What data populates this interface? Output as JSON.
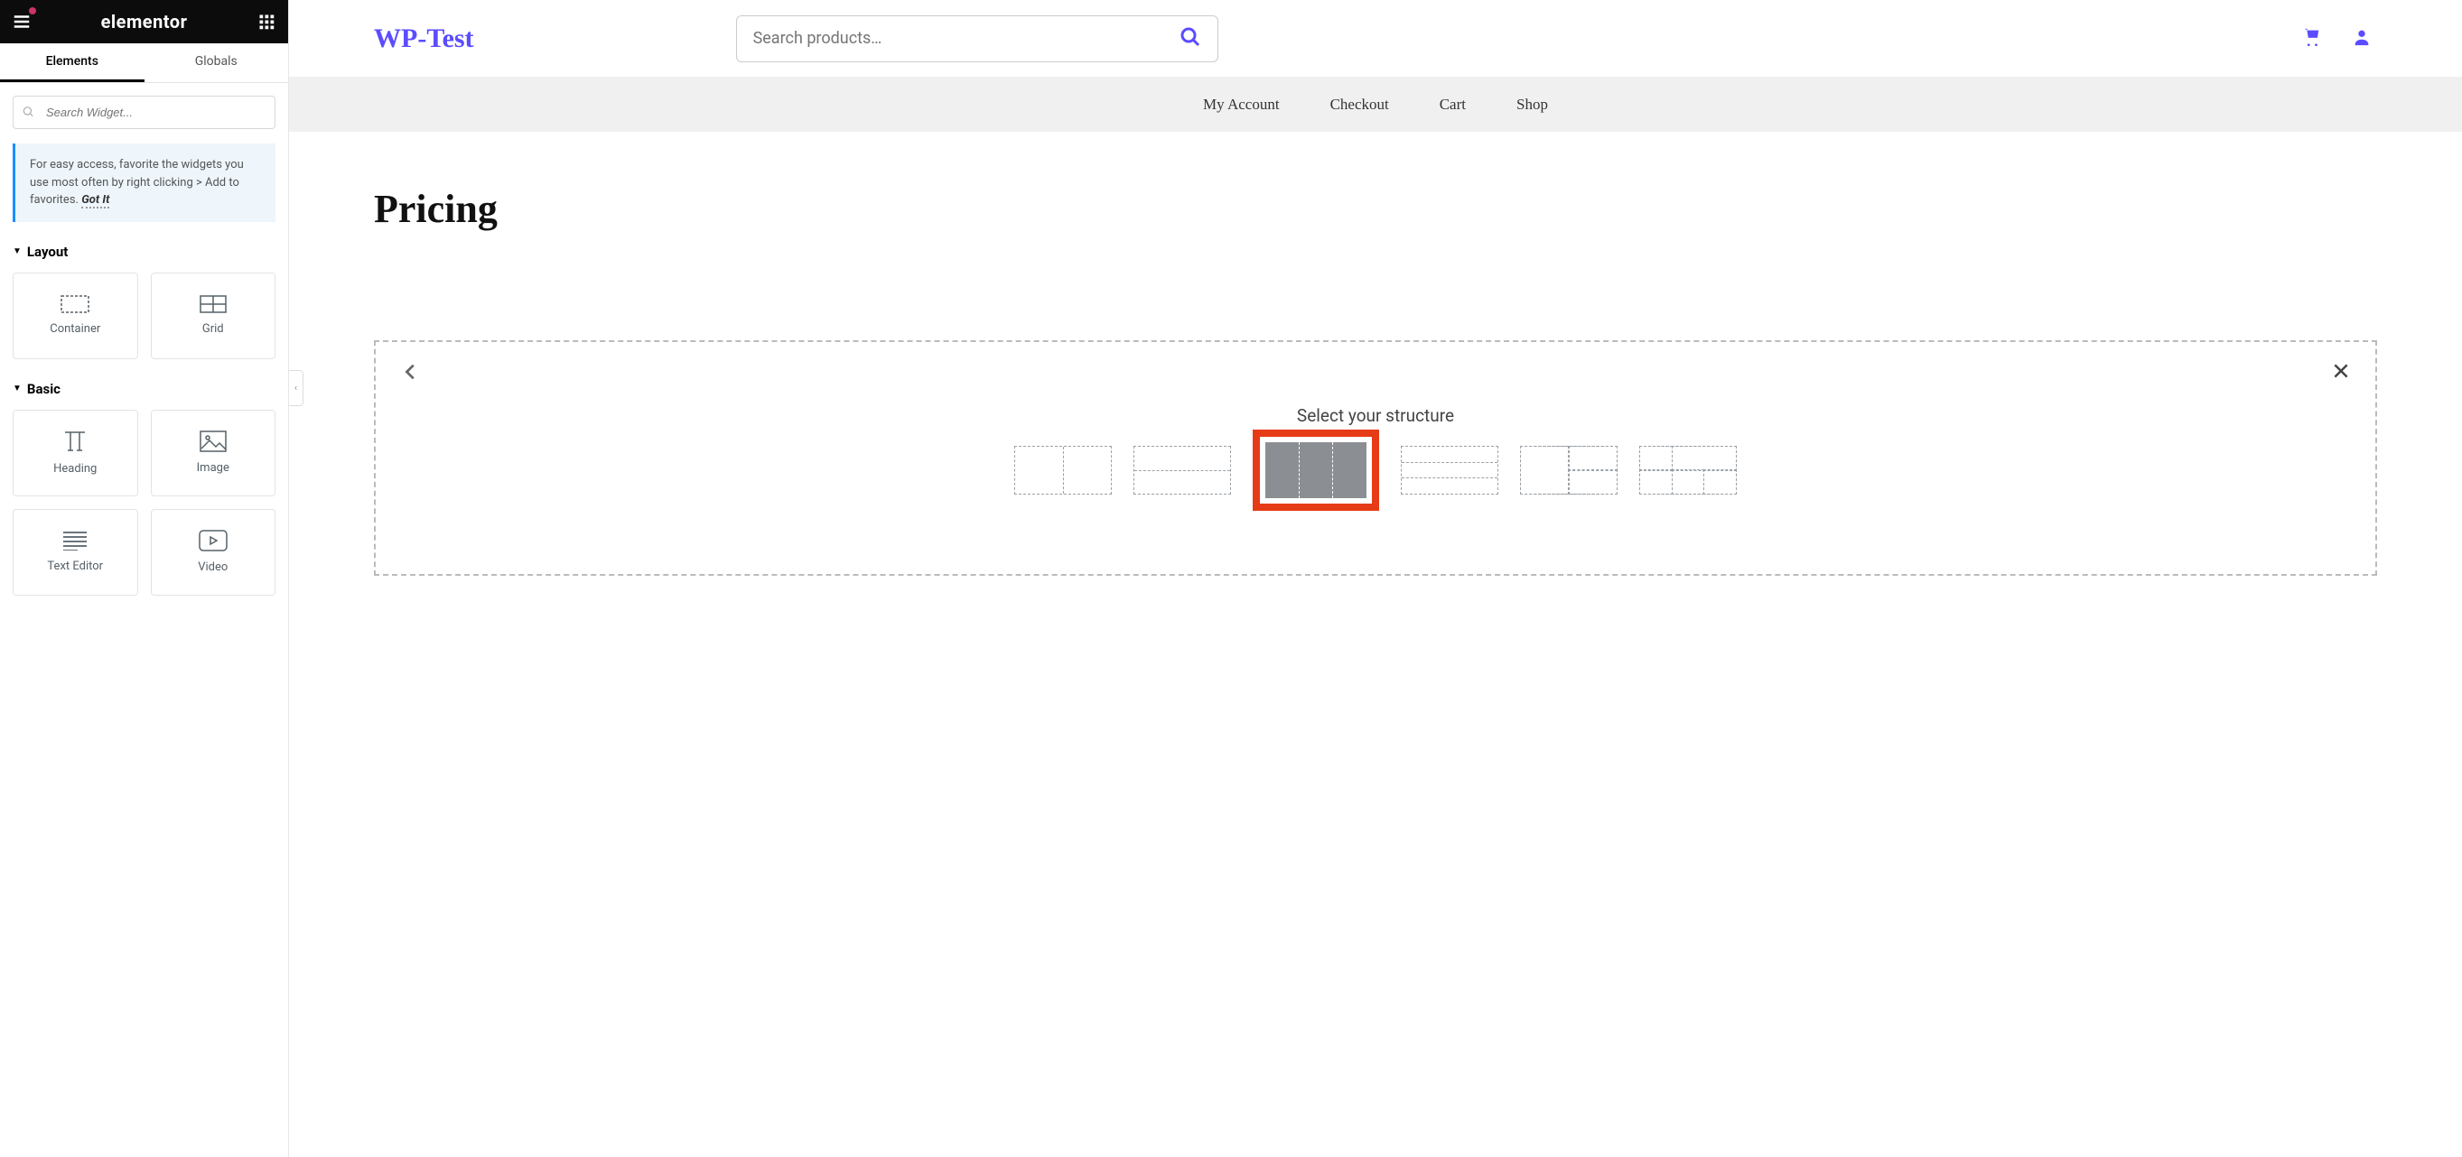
{
  "sidebar": {
    "logo": "elementor",
    "tabs": {
      "elements": "Elements",
      "globals": "Globals"
    },
    "search_placeholder": "Search Widget...",
    "tip": {
      "text": "For easy access, favorite the widgets you use most often by right clicking > Add to favorites.",
      "gotit": "Got It"
    },
    "cat_layout": "Layout",
    "cat_basic": "Basic",
    "widgets_layout": [
      {
        "name": "Container"
      },
      {
        "name": "Grid"
      }
    ],
    "widgets_basic": [
      {
        "name": "Heading"
      },
      {
        "name": "Image"
      },
      {
        "name": "Text Editor"
      },
      {
        "name": "Video"
      }
    ]
  },
  "site": {
    "title": "WP-Test",
    "search_placeholder": "Search products…",
    "nav": [
      "My Account",
      "Checkout",
      "Cart",
      "Shop"
    ],
    "page_title": "Pricing",
    "structure_heading": "Select your structure"
  }
}
